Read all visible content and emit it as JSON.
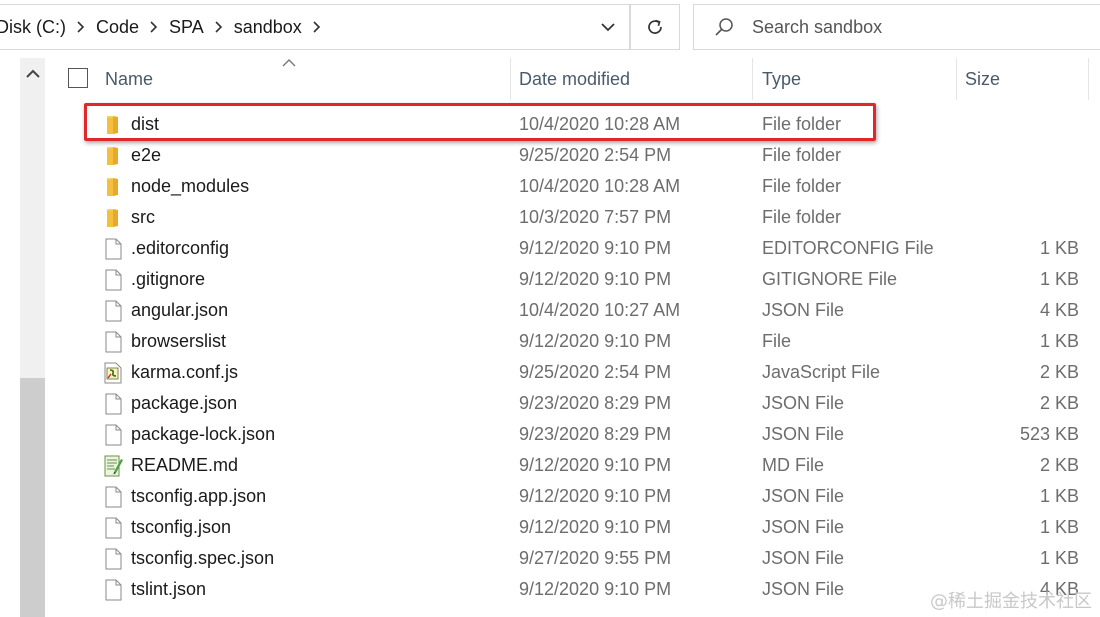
{
  "breadcrumb": [
    "Disk (C:)",
    "Code",
    "SPA",
    "sandbox"
  ],
  "search": {
    "placeholder": "Search sandbox"
  },
  "columns": {
    "name": "Name",
    "date": "Date modified",
    "type": "Type",
    "size": "Size"
  },
  "files": [
    {
      "name": "dist",
      "date": "10/4/2020 10:28 AM",
      "type": "File folder",
      "size": "",
      "icon": "folder-icon"
    },
    {
      "name": "e2e",
      "date": "9/25/2020 2:54 PM",
      "type": "File folder",
      "size": "",
      "icon": "folder-icon"
    },
    {
      "name": "node_modules",
      "date": "10/4/2020 10:28 AM",
      "type": "File folder",
      "size": "",
      "icon": "folder-icon"
    },
    {
      "name": "src",
      "date": "10/3/2020 7:57 PM",
      "type": "File folder",
      "size": "",
      "icon": "folder-icon"
    },
    {
      "name": ".editorconfig",
      "date": "9/12/2020 9:10 PM",
      "type": "EDITORCONFIG File",
      "size": "1 KB",
      "icon": "file-icon"
    },
    {
      "name": ".gitignore",
      "date": "9/12/2020 9:10 PM",
      "type": "GITIGNORE File",
      "size": "1 KB",
      "icon": "file-icon"
    },
    {
      "name": "angular.json",
      "date": "10/4/2020 10:27 AM",
      "type": "JSON File",
      "size": "4 KB",
      "icon": "file-icon"
    },
    {
      "name": "browserslist",
      "date": "9/12/2020 9:10 PM",
      "type": "File",
      "size": "1 KB",
      "icon": "file-icon"
    },
    {
      "name": "karma.conf.js",
      "date": "9/25/2020 2:54 PM",
      "type": "JavaScript File",
      "size": "2 KB",
      "icon": "js-file-icon"
    },
    {
      "name": "package.json",
      "date": "9/23/2020 8:29 PM",
      "type": "JSON File",
      "size": "2 KB",
      "icon": "file-icon"
    },
    {
      "name": "package-lock.json",
      "date": "9/23/2020 8:29 PM",
      "type": "JSON File",
      "size": "523 KB",
      "icon": "file-icon"
    },
    {
      "name": "README.md",
      "date": "9/12/2020 9:10 PM",
      "type": "MD File",
      "size": "2 KB",
      "icon": "md-file-icon"
    },
    {
      "name": "tsconfig.app.json",
      "date": "9/12/2020 9:10 PM",
      "type": "JSON File",
      "size": "1 KB",
      "icon": "file-icon"
    },
    {
      "name": "tsconfig.json",
      "date": "9/12/2020 9:10 PM",
      "type": "JSON File",
      "size": "1 KB",
      "icon": "file-icon"
    },
    {
      "name": "tsconfig.spec.json",
      "date": "9/27/2020 9:55 PM",
      "type": "JSON File",
      "size": "1 KB",
      "icon": "file-icon"
    },
    {
      "name": "tslint.json",
      "date": "9/12/2020 9:10 PM",
      "type": "JSON File",
      "size": "4 KB",
      "icon": "file-icon"
    }
  ],
  "highlighted_item": "dist",
  "colors": {
    "highlight_border": "#e0282a",
    "folder": "#f5c542",
    "header_text": "#4a5a6a",
    "meta_text": "#6d6d6d"
  },
  "watermark": "@稀土掘金技术社区"
}
